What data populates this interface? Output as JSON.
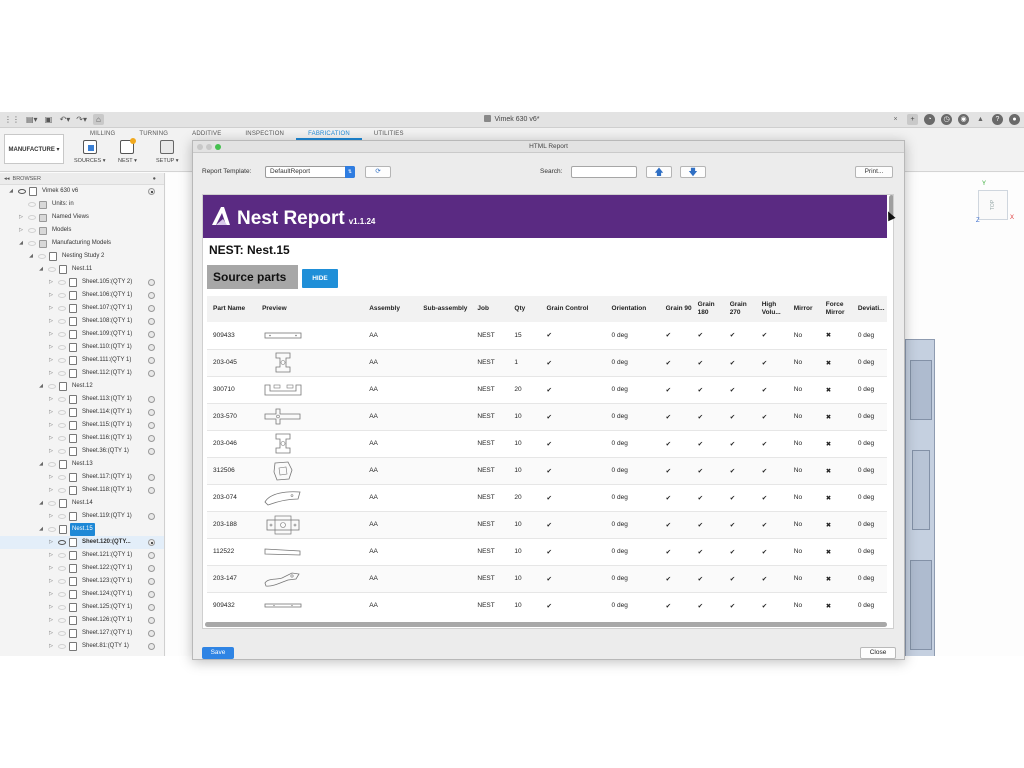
{
  "app": {
    "doc_title": "Vimek 630 v6*",
    "home_icon": "home-icon"
  },
  "ribbon": {
    "workspace": "MANUFACTURE ▾",
    "tabs": [
      {
        "label": "MILLING"
      },
      {
        "label": "TURNING"
      },
      {
        "label": "ADDITIVE"
      },
      {
        "label": "INSPECTION"
      },
      {
        "label": "FABRICATION",
        "active": true
      },
      {
        "label": "UTILITIES"
      }
    ],
    "groups": [
      {
        "label": "SOURCES ▾"
      },
      {
        "label": "NEST ▾"
      },
      {
        "label": "SETUP ▾"
      }
    ]
  },
  "browser": {
    "header": "BROWSER",
    "rows": [
      {
        "indent": 0,
        "toggle": "◢",
        "eye": true,
        "icon": "doc",
        "label": "Vimek 630 v6",
        "radio": "dot"
      },
      {
        "indent": 1,
        "toggle": "",
        "eye": false,
        "icon": "folder",
        "label": "Units: in"
      },
      {
        "indent": 1,
        "toggle": "▷",
        "eye": false,
        "icon": "folder",
        "label": "Named Views"
      },
      {
        "indent": 1,
        "toggle": "▷",
        "eye": false,
        "icon": "folder",
        "label": "Models"
      },
      {
        "indent": 1,
        "toggle": "◢",
        "eye": false,
        "icon": "folder",
        "label": "Manufacturing Models"
      },
      {
        "indent": 2,
        "toggle": "◢",
        "eye": false,
        "icon": "doc",
        "label": "Nesting Study 2"
      },
      {
        "indent": 3,
        "toggle": "◢",
        "eye": false,
        "icon": "doc",
        "label": "Nest.11"
      },
      {
        "indent": 4,
        "toggle": "▷",
        "eye": false,
        "icon": "doc",
        "label": "Sheet.105:(QTY 2)",
        "radio": "off"
      },
      {
        "indent": 4,
        "toggle": "▷",
        "eye": false,
        "icon": "doc",
        "label": "Sheet.106:(QTY 1)",
        "radio": "off"
      },
      {
        "indent": 4,
        "toggle": "▷",
        "eye": false,
        "icon": "doc",
        "label": "Sheet.107:(QTY 1)",
        "radio": "off"
      },
      {
        "indent": 4,
        "toggle": "▷",
        "eye": false,
        "icon": "doc",
        "label": "Sheet.108:(QTY 1)",
        "radio": "off"
      },
      {
        "indent": 4,
        "toggle": "▷",
        "eye": false,
        "icon": "doc",
        "label": "Sheet.109:(QTY 1)",
        "radio": "off"
      },
      {
        "indent": 4,
        "toggle": "▷",
        "eye": false,
        "icon": "doc",
        "label": "Sheet.110:(QTY 1)",
        "radio": "off"
      },
      {
        "indent": 4,
        "toggle": "▷",
        "eye": false,
        "icon": "doc",
        "label": "Sheet.111:(QTY 1)",
        "radio": "off"
      },
      {
        "indent": 4,
        "toggle": "▷",
        "eye": false,
        "icon": "doc",
        "label": "Sheet.112:(QTY 1)",
        "radio": "off"
      },
      {
        "indent": 3,
        "toggle": "◢",
        "eye": false,
        "icon": "doc",
        "label": "Nest.12"
      },
      {
        "indent": 4,
        "toggle": "▷",
        "eye": false,
        "icon": "doc",
        "label": "Sheet.113:(QTY 1)",
        "radio": "off"
      },
      {
        "indent": 4,
        "toggle": "▷",
        "eye": false,
        "icon": "doc",
        "label": "Sheet.114:(QTY 1)",
        "radio": "off"
      },
      {
        "indent": 4,
        "toggle": "▷",
        "eye": false,
        "icon": "doc",
        "label": "Sheet.115:(QTY 1)",
        "radio": "off"
      },
      {
        "indent": 4,
        "toggle": "▷",
        "eye": false,
        "icon": "doc",
        "label": "Sheet.116:(QTY 1)",
        "radio": "off"
      },
      {
        "indent": 4,
        "toggle": "▷",
        "eye": false,
        "icon": "doc",
        "label": "Sheet.36:(QTY 1)",
        "radio": "off"
      },
      {
        "indent": 3,
        "toggle": "◢",
        "eye": false,
        "icon": "doc",
        "label": "Nest.13"
      },
      {
        "indent": 4,
        "toggle": "▷",
        "eye": false,
        "icon": "doc",
        "label": "Sheet.117:(QTY 1)",
        "radio": "off"
      },
      {
        "indent": 4,
        "toggle": "▷",
        "eye": false,
        "icon": "doc",
        "label": "Sheet.118:(QTY 1)",
        "radio": "off"
      },
      {
        "indent": 3,
        "toggle": "◢",
        "eye": false,
        "icon": "doc",
        "label": "Nest.14"
      },
      {
        "indent": 4,
        "toggle": "▷",
        "eye": false,
        "icon": "doc",
        "label": "Sheet.119:(QTY 1)",
        "radio": "off"
      },
      {
        "indent": 3,
        "toggle": "◢",
        "eye": false,
        "icon": "doc",
        "label": "Nest.15",
        "selected": true
      },
      {
        "indent": 4,
        "toggle": "▷",
        "eye": true,
        "icon": "doc",
        "label": "Sheet.120:(QTY...",
        "radio": "on",
        "bold": true,
        "active": true
      },
      {
        "indent": 4,
        "toggle": "▷",
        "eye": false,
        "icon": "doc",
        "label": "Sheet.121:(QTY 1)",
        "radio": "off"
      },
      {
        "indent": 4,
        "toggle": "▷",
        "eye": false,
        "icon": "doc",
        "label": "Sheet.122:(QTY 1)",
        "radio": "off"
      },
      {
        "indent": 4,
        "toggle": "▷",
        "eye": false,
        "icon": "doc",
        "label": "Sheet.123:(QTY 1)",
        "radio": "off"
      },
      {
        "indent": 4,
        "toggle": "▷",
        "eye": false,
        "icon": "doc",
        "label": "Sheet.124:(QTY 1)",
        "radio": "off"
      },
      {
        "indent": 4,
        "toggle": "▷",
        "eye": false,
        "icon": "doc",
        "label": "Sheet.125:(QTY 1)",
        "radio": "off"
      },
      {
        "indent": 4,
        "toggle": "▷",
        "eye": false,
        "icon": "doc",
        "label": "Sheet.126:(QTY 1)",
        "radio": "off"
      },
      {
        "indent": 4,
        "toggle": "▷",
        "eye": false,
        "icon": "doc",
        "label": "Sheet.127:(QTY 1)",
        "radio": "off"
      },
      {
        "indent": 4,
        "toggle": "▷",
        "eye": false,
        "icon": "doc",
        "label": "Sheet.81:(QTY 1)",
        "radio": "off"
      }
    ]
  },
  "viewcube": {
    "face": "TOP",
    "x": "X",
    "y": "Y",
    "z": "Z"
  },
  "dialog": {
    "title": "HTML Report",
    "template_label": "Report Template:",
    "template_value": "DefaultReport",
    "search_label": "Search:",
    "search_value": "",
    "print_label": "Print...",
    "save_label": "Save",
    "close_label": "Close"
  },
  "report": {
    "title": "Nest Report",
    "version": "v1.1.24",
    "nest_label": "NEST: Nest.15",
    "section_title": "Source parts",
    "hide_label": "HIDE",
    "columns": [
      "Part Name",
      "Preview",
      "Assembly",
      "Sub-assembly",
      "Job",
      "Qty",
      "Grain Control",
      "Orientation",
      "Grain 90",
      "Grain 180",
      "Grain 270",
      "High Volu...",
      "Mirror",
      "Force Mirror",
      "Deviati..."
    ],
    "rows": [
      {
        "part": "909433",
        "shape": "bar",
        "assembly": "AA",
        "job": "NEST",
        "qty": "15",
        "grain_control": "✔",
        "orientation": "0 deg",
        "g90": "✔",
        "g180": "✔",
        "g270": "✔",
        "high": "✔",
        "mirror": "No",
        "force": "✖",
        "deviation": "0 deg"
      },
      {
        "part": "203-045",
        "shape": "bracket",
        "assembly": "AA",
        "job": "NEST",
        "qty": "1",
        "grain_control": "✔",
        "orientation": "0 deg",
        "g90": "✔",
        "g180": "✔",
        "g270": "✔",
        "high": "✔",
        "mirror": "No",
        "force": "✖",
        "deviation": "0 deg"
      },
      {
        "part": "300710",
        "shape": "channel",
        "assembly": "AA",
        "job": "NEST",
        "qty": "20",
        "grain_control": "✔",
        "orientation": "0 deg",
        "g90": "✔",
        "g180": "✔",
        "g270": "✔",
        "high": "✔",
        "mirror": "No",
        "force": "✖",
        "deviation": "0 deg"
      },
      {
        "part": "203-570",
        "shape": "cross",
        "assembly": "AA",
        "job": "NEST",
        "qty": "10",
        "grain_control": "✔",
        "orientation": "0 deg",
        "g90": "✔",
        "g180": "✔",
        "g270": "✔",
        "high": "✔",
        "mirror": "No",
        "force": "✖",
        "deviation": "0 deg"
      },
      {
        "part": "203-046",
        "shape": "bracket",
        "assembly": "AA",
        "job": "NEST",
        "qty": "10",
        "grain_control": "✔",
        "orientation": "0 deg",
        "g90": "✔",
        "g180": "✔",
        "g270": "✔",
        "high": "✔",
        "mirror": "No",
        "force": "✖",
        "deviation": "0 deg"
      },
      {
        "part": "312506",
        "shape": "blob",
        "assembly": "AA",
        "job": "NEST",
        "qty": "10",
        "grain_control": "✔",
        "orientation": "0 deg",
        "g90": "✔",
        "g180": "✔",
        "g270": "✔",
        "high": "✔",
        "mirror": "No",
        "force": "✖",
        "deviation": "0 deg"
      },
      {
        "part": "203-074",
        "shape": "wing",
        "assembly": "AA",
        "job": "NEST",
        "qty": "20",
        "grain_control": "✔",
        "orientation": "0 deg",
        "g90": "✔",
        "g180": "✔",
        "g270": "✔",
        "high": "✔",
        "mirror": "No",
        "force": "✖",
        "deviation": "0 deg"
      },
      {
        "part": "203-188",
        "shape": "block",
        "assembly": "AA",
        "job": "NEST",
        "qty": "10",
        "grain_control": "✔",
        "orientation": "0 deg",
        "g90": "✔",
        "g180": "✔",
        "g270": "✔",
        "high": "✔",
        "mirror": "No",
        "force": "✖",
        "deviation": "0 deg"
      },
      {
        "part": "112522",
        "shape": "taper",
        "assembly": "AA",
        "job": "NEST",
        "qty": "10",
        "grain_control": "✔",
        "orientation": "0 deg",
        "g90": "✔",
        "g180": "✔",
        "g270": "✔",
        "high": "✔",
        "mirror": "No",
        "force": "✖",
        "deviation": "0 deg"
      },
      {
        "part": "203-147",
        "shape": "hook",
        "assembly": "AA",
        "job": "NEST",
        "qty": "10",
        "grain_control": "✔",
        "orientation": "0 deg",
        "g90": "✔",
        "g180": "✔",
        "g270": "✔",
        "high": "✔",
        "mirror": "No",
        "force": "✖",
        "deviation": "0 deg"
      },
      {
        "part": "909432",
        "shape": "thinbar",
        "assembly": "AA",
        "job": "NEST",
        "qty": "10",
        "grain_control": "✔",
        "orientation": "0 deg",
        "g90": "✔",
        "g180": "✔",
        "g270": "✔",
        "high": "✔",
        "mirror": "No",
        "force": "✖",
        "deviation": "0 deg"
      }
    ]
  },
  "colors": {
    "banner": "#5a2a82",
    "accent": "#1e88d6",
    "section_bg": "#a7a7a7"
  }
}
